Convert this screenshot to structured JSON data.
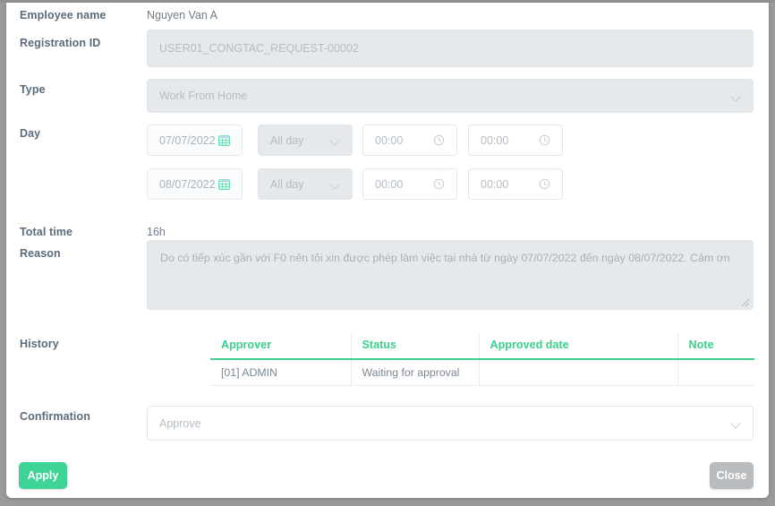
{
  "form": {
    "employee_name": {
      "label": "Employee name",
      "value": "Nguyen Van A"
    },
    "registration_id": {
      "label": "Registration ID",
      "value": "USER01_CONGTAC_REQUEST-00002"
    },
    "type": {
      "label": "Type",
      "value": "Work From Home"
    },
    "day": {
      "label": "Day",
      "rows": [
        {
          "date": "07/07/2022",
          "period": "All day",
          "time_from": "00:00",
          "time_to": "00:00"
        },
        {
          "date": "08/07/2022",
          "period": "All day",
          "time_from": "00:00",
          "time_to": "00:00"
        }
      ]
    },
    "total_time": {
      "label": "Total time",
      "value": "16h"
    },
    "reason": {
      "label": "Reason",
      "value": "Do có tiếp xúc gần với F0 nên tôi xin được phép làm việc tại nhà từ ngày 07/07/2022 đến ngày 08/07/2022. Cảm ơn"
    },
    "history": {
      "label": "History"
    },
    "confirmation": {
      "label": "Confirmation",
      "value": "Approve"
    }
  },
  "history_table": {
    "columns": [
      "Approver",
      "Status",
      "Approved date",
      "Note"
    ],
    "rows": [
      [
        "[01] ADMIN",
        "Waiting for approval",
        "",
        ""
      ]
    ]
  },
  "actions": {
    "apply_label": "Apply",
    "close_label": "Close"
  },
  "icons": {
    "calendar": "calendar-icon",
    "clock": "clock-icon",
    "chevron": "chevron-down-icon",
    "resize": "resize-grip-icon"
  },
  "colors": {
    "accent_green": "#3ed397",
    "table_header_green": "#3ccf8e",
    "close_gray": "#b9bcbf",
    "label_text": "#5b6b7b",
    "field_bg_disabled": "#e5e9ec"
  }
}
